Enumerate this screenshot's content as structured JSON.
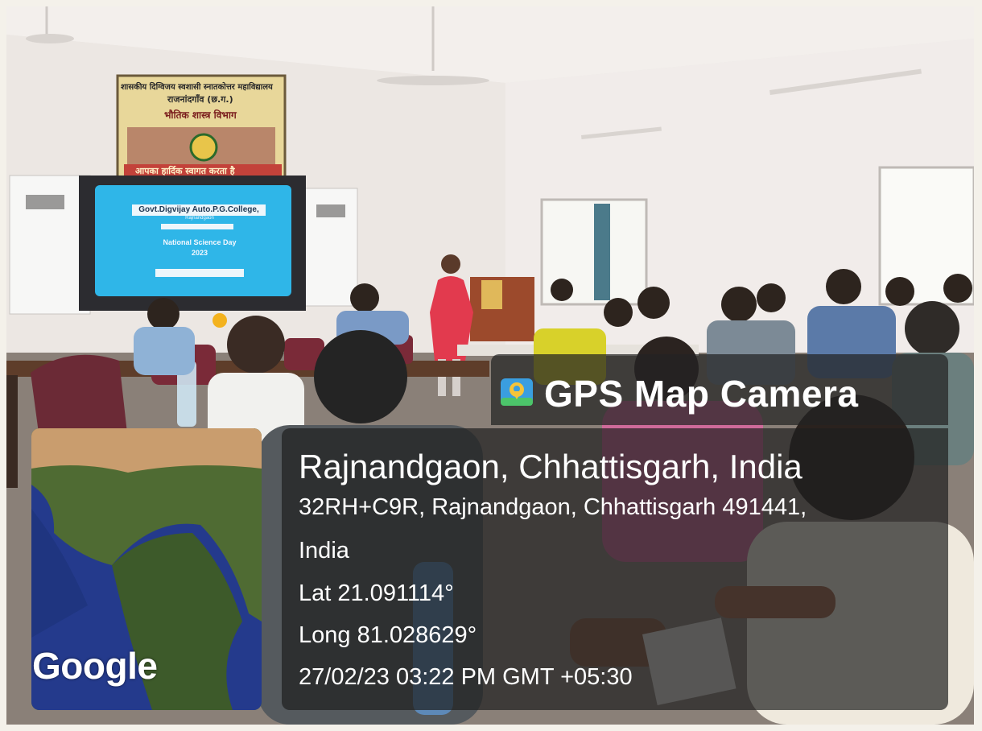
{
  "overlay": {
    "app_name": "GPS Map Camera",
    "location_title": "Rajnandgaon, Chhattisgarh, India",
    "address_line1": "32RH+C9R, Rajnandgaon, Chhattisgarh 491441,",
    "address_line2": "India",
    "latitude": "Lat 21.091114°",
    "longitude": "Long 81.028629°",
    "datetime": "27/02/23 03:22 PM GMT +05:30",
    "map_logo": "Google"
  },
  "scene": {
    "banner_line1": "शासकीय दिग्विजय स्वशासी स्नातकोत्तर महाविद्यालय",
    "banner_line2": "राजनांदगाँव (छ.ग.)",
    "banner_line3": "भौतिक शास्त्र विभाग",
    "banner_line4": "आपका हार्दिक स्वागत करता है",
    "screen_title": "Govt.Digvijay Auto.P.G.College,",
    "screen_subtitle": "Rajnandgaon",
    "screen_event": "National Science Day",
    "screen_year": "2023"
  },
  "colors": {
    "overlay_bg": "#232323",
    "screen_blue": "#2fb6e8",
    "presenter_dress": "#e23a4e",
    "wall": "#efebe8"
  },
  "icons": [
    "gps-camera-icon"
  ]
}
